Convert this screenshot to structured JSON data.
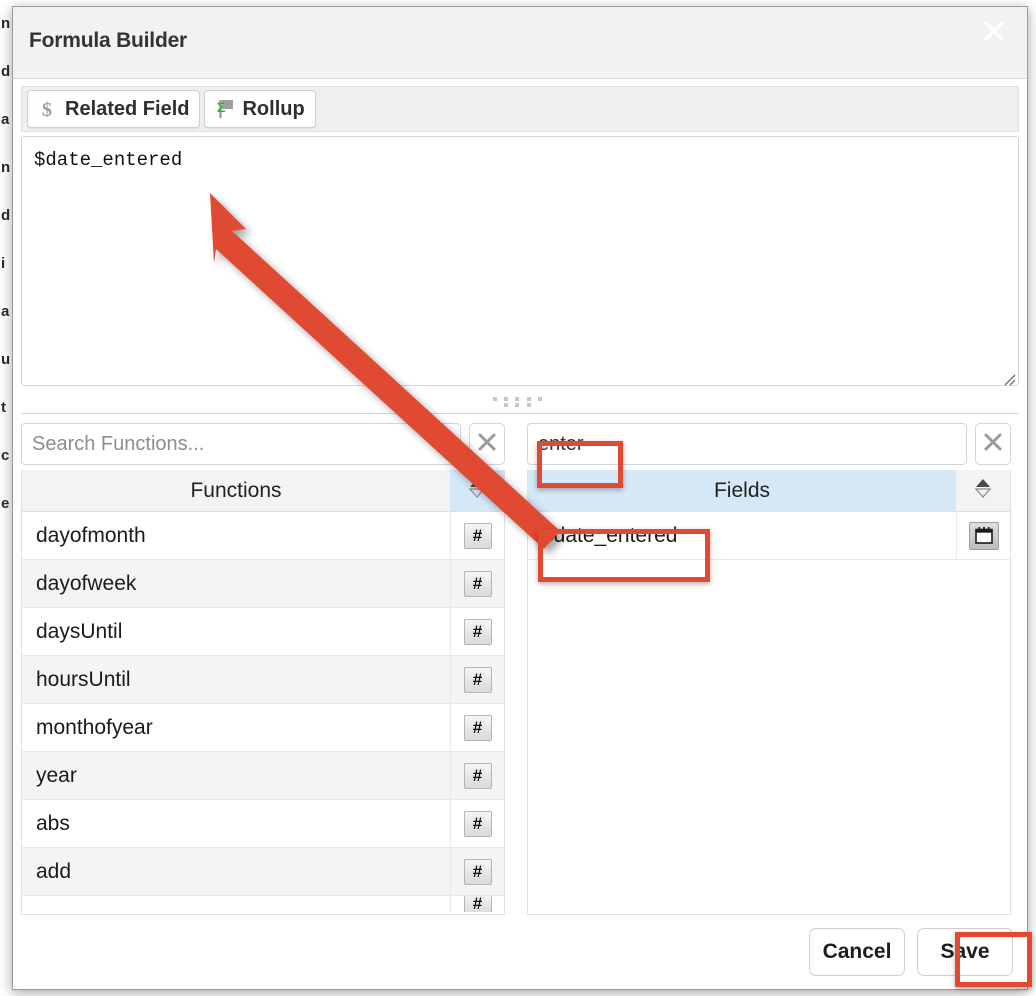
{
  "window": {
    "title": "Formula Builder",
    "close_icon": "close-x-icon"
  },
  "toolbar": {
    "buttons": [
      {
        "label": "Related Field",
        "icon": "dollar-sign-icon"
      },
      {
        "label": "Rollup",
        "icon": "sigma-flag-icon"
      }
    ]
  },
  "formula": {
    "value": "$date_entered",
    "placeholder": "",
    "resize_handle_icon": "resize-grip-icon",
    "drag_handle_icon": "drag-dots-icon"
  },
  "functions_panel": {
    "search": {
      "value": "",
      "placeholder": "Search Functions...",
      "clear_icon": "clear-x-icon"
    },
    "column_header": "Functions",
    "sort_icon": "sort-updown-icon",
    "rows": [
      {
        "name": "dayofmonth",
        "icon": "hash-icon"
      },
      {
        "name": "dayofweek",
        "icon": "hash-icon"
      },
      {
        "name": "daysUntil",
        "icon": "hash-icon"
      },
      {
        "name": "hoursUntil",
        "icon": "hash-icon"
      },
      {
        "name": "monthofyear",
        "icon": "hash-icon"
      },
      {
        "name": "year",
        "icon": "hash-icon"
      },
      {
        "name": "abs",
        "icon": "hash-icon"
      },
      {
        "name": "add",
        "icon": "hash-icon"
      }
    ]
  },
  "fields_panel": {
    "search": {
      "value": "enter",
      "placeholder": "",
      "clear_icon": "clear-x-icon"
    },
    "column_header": "Fields",
    "sort_icon": "sort-updown-icon",
    "rows": [
      {
        "name": "$date_entered",
        "icon": "calendar-icon"
      }
    ]
  },
  "footer": {
    "cancel_label": "Cancel",
    "save_label": "Save"
  },
  "annotations": {
    "color": "#e04a33",
    "boxes": [
      {
        "target": "fields-search-input"
      },
      {
        "target": "fields-row-date-entered"
      },
      {
        "target": "save-button"
      }
    ],
    "arrow": {
      "from": "fields-row-date-entered",
      "to": "formula-textarea"
    }
  },
  "background_edge": {
    "lines": [
      "n",
      "d",
      "a",
      "n",
      "d",
      "i",
      "a",
      "u",
      "t",
      "c",
      "e"
    ]
  }
}
